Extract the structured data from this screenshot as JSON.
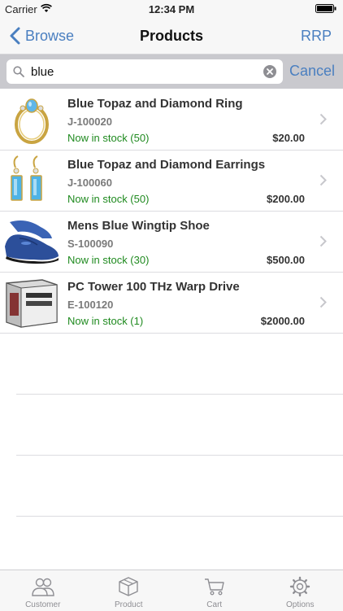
{
  "status_bar": {
    "carrier": "Carrier",
    "time": "12:34 PM"
  },
  "nav": {
    "back_label": "Browse",
    "title": "Products",
    "right_label": "RRP"
  },
  "search": {
    "value": "blue",
    "cancel_label": "Cancel"
  },
  "products": [
    {
      "name": "Blue Topaz and Diamond Ring",
      "sku": "J-100020",
      "stock": "Now in stock (50)",
      "price": "$20.00"
    },
    {
      "name": "Blue Topaz and Diamond Earrings",
      "sku": "J-100060",
      "stock": "Now in stock (50)",
      "price": "$200.00"
    },
    {
      "name": "Mens Blue Wingtip Shoe",
      "sku": "S-100090",
      "stock": "Now in stock (30)",
      "price": "$500.00"
    },
    {
      "name": "PC Tower 100 THz Warp Drive",
      "sku": "E-100120",
      "stock": "Now in stock (1)",
      "price": "$2000.00"
    }
  ],
  "tabs": [
    {
      "label": "Customer",
      "icon": "customers-icon"
    },
    {
      "label": "Product",
      "icon": "box-icon"
    },
    {
      "label": "Cart",
      "icon": "cart-icon"
    },
    {
      "label": "Options",
      "icon": "gear-icon"
    }
  ],
  "colors": {
    "accent": "#4a7fc0",
    "in_stock": "#1f8a1f",
    "search_bg": "#c9c9ce"
  }
}
